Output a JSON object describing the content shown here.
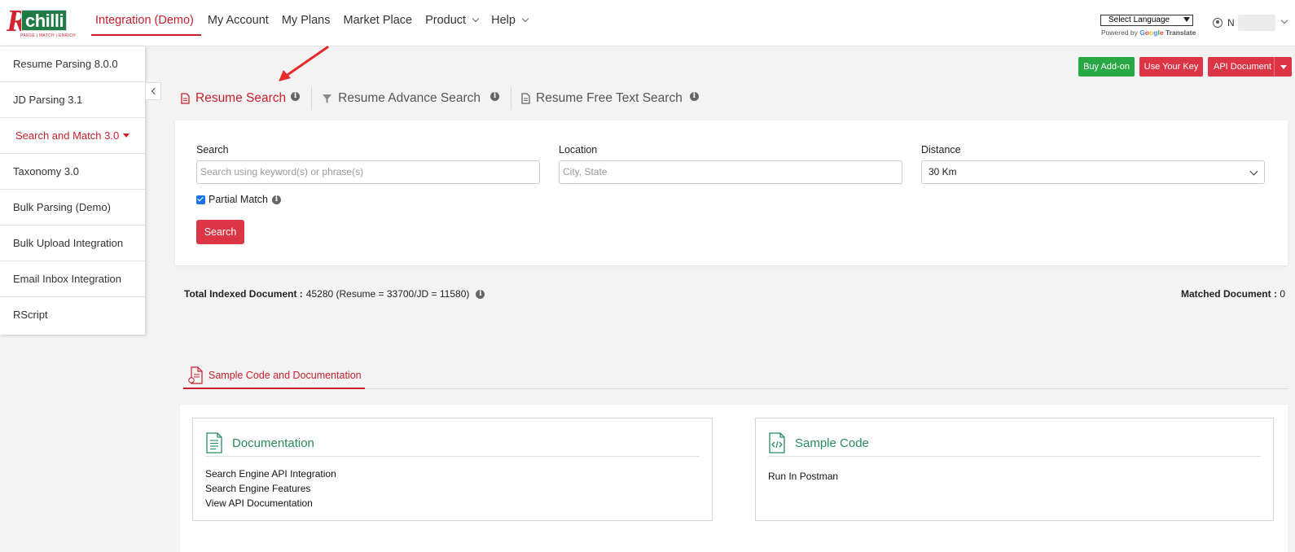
{
  "logo": {
    "brand": "chilli",
    "tagline": "PARSE | MATCH | ENRICH"
  },
  "nav": {
    "items": [
      {
        "label": "Integration (Demo)",
        "active": true
      },
      {
        "label": "My Account"
      },
      {
        "label": "My Plans"
      },
      {
        "label": "Market Place"
      },
      {
        "label": "Product",
        "dropdown": true
      },
      {
        "label": "Help",
        "dropdown": true
      }
    ]
  },
  "language": {
    "selected": "Select Language",
    "powered_prefix": "Powered by",
    "google": "Google",
    "translate": "Translate"
  },
  "user": {
    "initial": "N"
  },
  "sidebar": {
    "items": [
      {
        "label": "Resume Parsing 8.0.0"
      },
      {
        "label": "JD Parsing 3.1"
      },
      {
        "label": "Search and Match 3.0",
        "active": true
      },
      {
        "label": "Taxonomy 3.0"
      },
      {
        "label": "Bulk Parsing (Demo)"
      },
      {
        "label": "Bulk Upload Integration"
      },
      {
        "label": "Email Inbox Integration"
      },
      {
        "label": "RScript"
      }
    ]
  },
  "actions": {
    "buy_addon": "Buy Add-on",
    "use_key": "Use Your Key",
    "api_doc": "API Document"
  },
  "tabs": [
    {
      "label": "Resume Search",
      "active": true
    },
    {
      "label": "Resume Advance Search"
    },
    {
      "label": "Resume Free Text Search"
    }
  ],
  "form": {
    "search_label": "Search",
    "search_placeholder": "Search using keyword(s) or phrase(s)",
    "location_label": "Location",
    "location_placeholder": "City, State",
    "distance_label": "Distance",
    "distance_value": "30 Km",
    "partial_match": "Partial Match",
    "partial_match_checked": true,
    "search_button": "Search"
  },
  "stats": {
    "total_label": "Total Indexed Document :",
    "total_value": "45280 (Resume = 33700/JD = 11580)",
    "matched_label": "Matched Document :",
    "matched_value": "0"
  },
  "sample": {
    "tab_label": "Sample Code and Documentation",
    "documentation": {
      "title": "Documentation",
      "links": [
        "Search Engine API Integration",
        "Search Engine Features",
        "View API Documentation"
      ]
    },
    "code": {
      "title": "Sample Code",
      "links": [
        "Run In Postman"
      ]
    }
  },
  "colors": {
    "accent_red": "#c8202d",
    "brand_green": "#1e7b46",
    "doc_green": "#2a8a5c",
    "button_green": "#28a745",
    "button_red": "#dc3545"
  }
}
